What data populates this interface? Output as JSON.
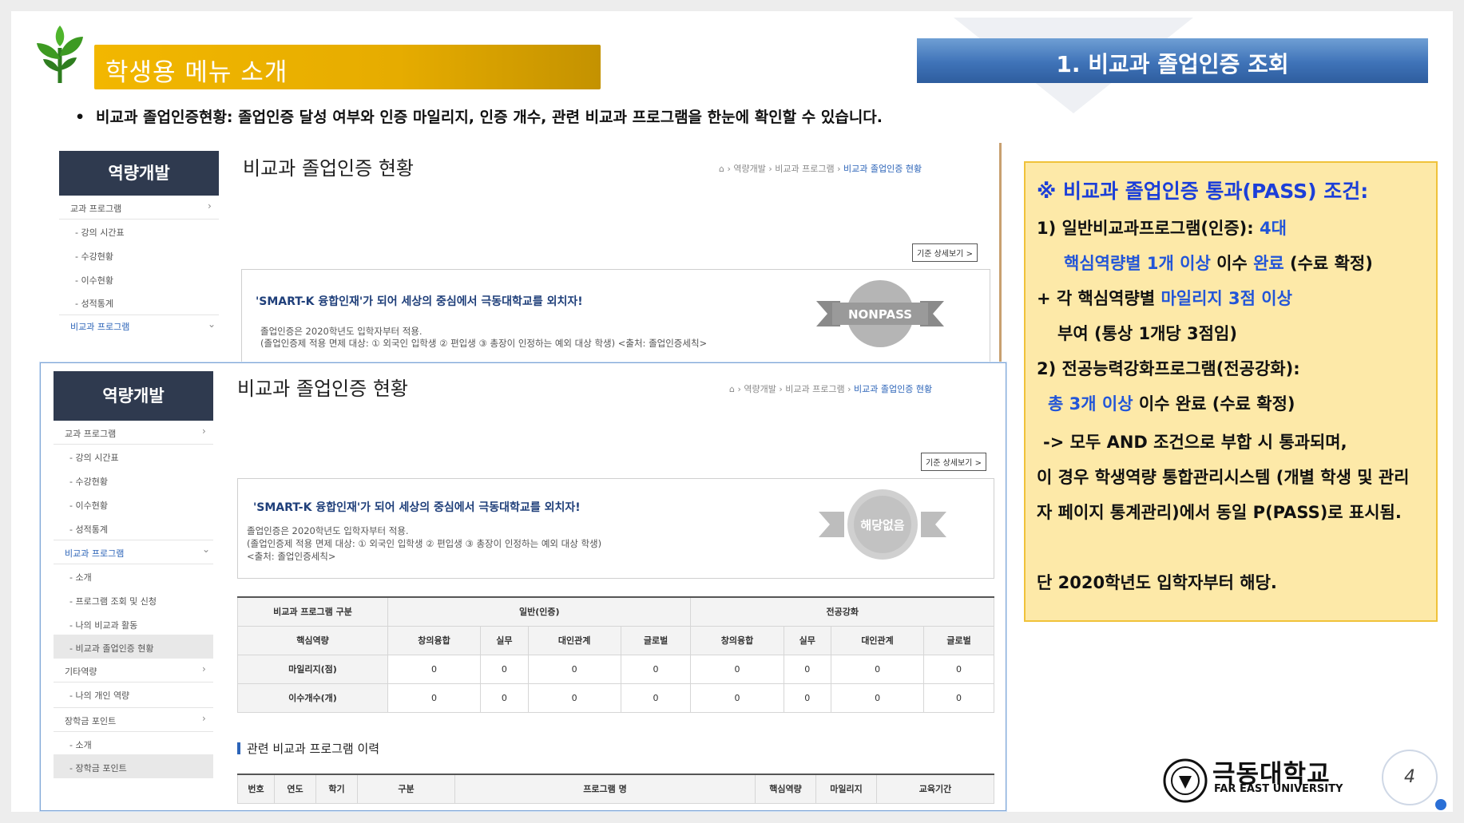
{
  "header": {
    "menu_title": "학생용 메뉴 소개",
    "section_title": "1. 비교과 졸업인증 조회"
  },
  "description": "비교과 졸업인증현황: 졸업인증 달성 여부와 인증 마일리지, 인증 개수, 관련 비교과 프로그램을 한눈에 확인할 수 있습니다.",
  "screen_a": {
    "sidebar_title": "역량개발",
    "sidebar_items": [
      "교과 프로그램",
      "강의 시간표",
      "수강현황",
      "이수현황",
      "성적통계",
      "비교과 프로그램"
    ],
    "page_title": "비교과 졸업인증 현황",
    "breadcrumb": [
      "역량개발",
      "비교과 프로그램",
      "비교과 졸업인증 현황"
    ],
    "detail_button": "기준 상세보기",
    "slogan": "'SMART-K 융합인재'가 되어 세상의 중심에서 극동대학교를 외치자!",
    "note1": "졸업인증은 2020학년도 입학자부터 적용.",
    "note2": "(졸업인증제 적용 면제 대상: ① 외국인 입학생 ② 편입생 ③ 총장이 인정하는 예외 대상 학생) <출처: 졸업인증세칙>",
    "badge": "NONPASS"
  },
  "screen_b": {
    "sidebar_title": "역량개발",
    "sidebar_items": [
      "교과 프로그램",
      "강의 시간표",
      "수강현황",
      "이수현황",
      "성적통계",
      "비교과 프로그램",
      "소개",
      "프로그램 조회 및 신청",
      "나의 비교과 활동",
      "비교과 졸업인증 현황",
      "기타역량",
      "나의 개인 역량",
      "장학금 포인트",
      "소개",
      "장학금 포인트"
    ],
    "page_title": "비교과 졸업인증 현황",
    "breadcrumb": [
      "역량개발",
      "비교과 프로그램",
      "비교과 졸업인증 현황"
    ],
    "detail_button": "기준 상세보기",
    "slogan": "'SMART-K 융합인재'가 되어 세상의 중심에서 극동대학교를 외치자!",
    "note1": "졸업인증은 2020학년도 입학자부터 적용.",
    "note2": "(졸업인증제 적용 면제 대상: ① 외국인 입학생 ② 편입생 ③ 총장이 인정하는 예외 대상 학생)",
    "note3": "<출처: 졸업인증세칙>",
    "badge": "해당없음",
    "table": {
      "group_label": "비교과 프로그램 구분",
      "group_general": "일반(인증)",
      "group_major": "전공강화",
      "competency_label": "핵심역량",
      "competencies": [
        "창의융합",
        "실무",
        "대인관계",
        "글로벌",
        "창의융합",
        "실무",
        "대인관계",
        "글로벌"
      ],
      "rows": [
        {
          "label": "마일리지(점)",
          "values": [
            "0",
            "0",
            "0",
            "0",
            "0",
            "0",
            "0",
            "0"
          ]
        },
        {
          "label": "이수개수(개)",
          "values": [
            "0",
            "0",
            "0",
            "0",
            "0",
            "0",
            "0",
            "0"
          ]
        }
      ]
    },
    "history_title": "관련 비교과 프로그램 이력",
    "history_columns": [
      "번호",
      "연도",
      "학기",
      "구분",
      "프로그램 명",
      "핵심역량",
      "마일리지",
      "교육기간"
    ]
  },
  "conditions": {
    "title": "※ 비교과 졸업인증 통과(PASS) 조건:",
    "l1a": "1)    일반비교과프로그램(인증): ",
    "l1b": "4대",
    "l2a": "핵심역량별 1개 이상",
    "l2b": " 이수 ",
    "l2c": "완료",
    "l2d": "  (수료 확정)",
    "l3a": "+  각 핵심역량별 ",
    "l3b": "마일리지 3점 이상",
    "l4": "부여 (통상 1개당 3점임)",
    "l5": "2) 전공능력강화프로그램(전공강화):",
    "l6a": "총 3개 이상",
    "l6b": " 이수 완료  (수료 확정)",
    "l7": "-> 모두 AND 조건으로 부합 시 통과되며,",
    "l8": "이 경우 학생역량 통합관리시스템 (개별 학생 및 관리",
    "l9": "자 페이지 통계관리)에서 동일 P(PASS)로 표시됨.",
    "l10": "단 2020학년도 입학자부터 해당."
  },
  "footer": {
    "logo_ko": "극동대학교",
    "logo_en": "FAR EAST UNIVERSITY",
    "page_number": "4"
  },
  "colors": {
    "title_gold": "#f2b700",
    "section_blue": "#3f73b8",
    "sidebar_dark": "#2f3a4f",
    "cond_bg": "#fde9a8",
    "highlight_blue": "#2255d8"
  }
}
